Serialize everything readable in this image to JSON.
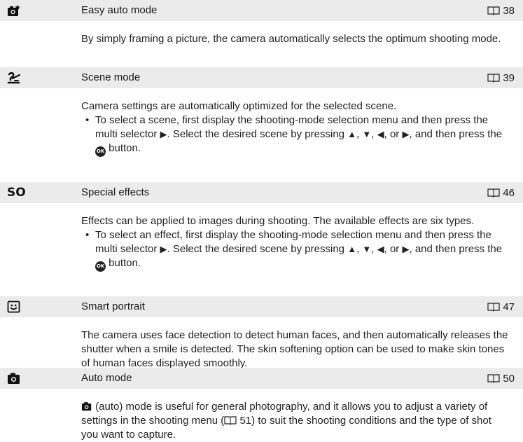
{
  "sections": [
    {
      "icon": "easy-auto-camera-icon",
      "title": "Easy auto mode",
      "page_ref": "38",
      "text": "By simply framing a picture, the camera automatically selects the optimum shooting mode."
    },
    {
      "icon": "scene-mode-icon",
      "title": "Scene mode",
      "page_ref": "39",
      "text": "Camera settings are automatically optimized for the selected scene.",
      "bullet": {
        "part1": "To select a scene, first display the shooting-mode selection menu and then press the multi selector ",
        "part2": ". Select the desired scene by pressing ",
        "sep1": ", ",
        "sep2": ", ",
        "sep3": ", or",
        "part3": ", and then press the ",
        "part4": " button."
      }
    },
    {
      "icon": "special-effects-icon",
      "icon_text": "SO",
      "title": "Special effects",
      "page_ref": "46",
      "text": "Effects can be applied to images during shooting. The available effects are six types.",
      "bullet": {
        "part1": "To select an effect, first display the shooting-mode selection menu and then press the multi selector ",
        "part2": ". Select the desired scene by pressing ",
        "sep1": ", ",
        "sep2": ", ",
        "sep3": ", or",
        "part3": ", and then press the ",
        "part4": " button."
      }
    },
    {
      "icon": "smart-portrait-icon",
      "title": "Smart portrait",
      "page_ref": "47",
      "text": "The camera uses face detection to detect human faces, and then automatically releases the shutter when a smile is detected. The skin softening option can be used to make skin tones of human faces displayed smoothly."
    },
    {
      "icon": "auto-mode-camera-icon",
      "title": "Auto mode",
      "page_ref": "50",
      "text_part1": " (auto) mode is useful for general photography, and it allows you to adjust a variety of settings in the shooting menu (",
      "text_ref": "51",
      "text_part2": ") to suit the shooting conditions and the type of shot you want to capture."
    }
  ],
  "ok_label": "OK",
  "book_icon": "book-reference-icon"
}
